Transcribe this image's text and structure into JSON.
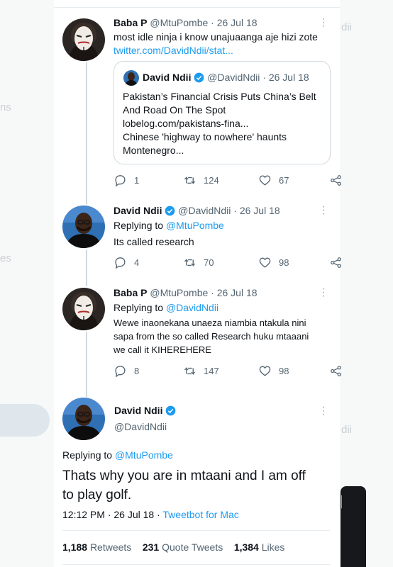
{
  "background_fragments": {
    "left_1": "ns",
    "left_2": "es",
    "right_1": "dii",
    "right_2": "dii"
  },
  "tweets": [
    {
      "author": "Baba P",
      "handle": "@MtuPombe",
      "date": "· 26 Jul 18",
      "text": "most idle ninja i know unajuaanga aje hizi zote",
      "link": "twitter.com/DavidNdii/stat...",
      "quote": {
        "author": "David Ndii",
        "handle": "@DavidNdii",
        "date": "· 26 Jul 18",
        "line1": "Pakistan’s Financial Crisis Puts China’s Belt",
        "line2": "And Road On The Spot",
        "line3": "lobelog.com/pakistans-fina...",
        "line4": "Chinese 'highway to nowhere' haunts",
        "line5": "Montenegro..."
      },
      "replies": "1",
      "retweets": "124",
      "likes": "67"
    },
    {
      "author": "David Ndii",
      "handle": "@DavidNdii",
      "date": "· 26 Jul 18",
      "replying_prefix": "Replying to",
      "replying_to": "@MtuPombe",
      "text": "Its called research",
      "replies": "4",
      "retweets": "70",
      "likes": "98"
    },
    {
      "author": "Baba P",
      "handle": "@MtuPombe",
      "date": "· 26 Jul 18",
      "replying_prefix": "Replying to",
      "replying_to": "@DavidNdii",
      "line1": "Wewe inaonekana unaeza niambia ntakula nini",
      "line2": "sapa from the so called Research huku mtaaani",
      "line3": "we call it KIHEREHERE",
      "replies": "8",
      "retweets": "147",
      "likes": "98"
    }
  ],
  "main_tweet": {
    "author": "David Ndii",
    "handle": "@DavidNdii",
    "replying_prefix": "Replying to",
    "replying_to": "@MtuPombe",
    "line1": "Thats why you are in mtaani and I am off",
    "line2": "to play golf.",
    "time": "12:12 PM · 26 Jul 18 ·",
    "source": "Tweetbot for Mac",
    "retweets_count": "1,188",
    "retweets_label": "Retweets",
    "quotes_count": "231",
    "quotes_label": "Quote Tweets",
    "likes_count": "1,384",
    "likes_label": "Likes"
  },
  "colors": {
    "accent": "#1d9bf0",
    "muted": "#536471",
    "verified": "#1d9bf0"
  },
  "icons": [
    "reply-icon",
    "retweet-icon",
    "like-icon",
    "share-icon",
    "verified-icon",
    "more-icon"
  ]
}
